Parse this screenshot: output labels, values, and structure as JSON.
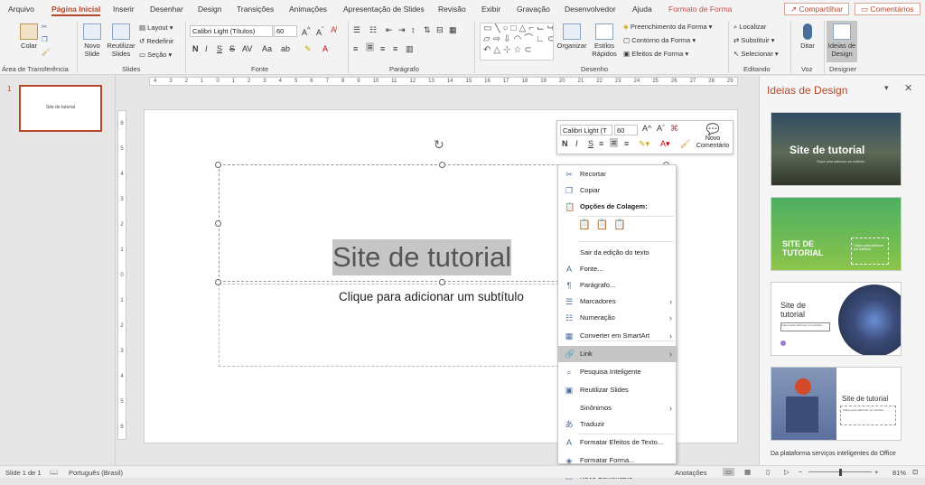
{
  "menu": {
    "tabs": [
      "Arquivo",
      "Página Inicial",
      "Inserir",
      "Desenhar",
      "Design",
      "Transições",
      "Animações",
      "Apresentação de Slides",
      "Revisão",
      "Exibir",
      "Gravação",
      "Desenvolvedor",
      "Ajuda",
      "Formato de Forma"
    ],
    "share": "Compartilhar",
    "comments": "Comentários"
  },
  "ribbon": {
    "clipboard": {
      "paste": "Colar",
      "label": "Área de Transferência"
    },
    "slides": {
      "new": "Novo Slide",
      "reuse": "Reutilizar Slides",
      "layout": "Layout",
      "reset": "Redefinir",
      "section": "Seção",
      "label": "Slides"
    },
    "font": {
      "name": "Calibri Light (Títulos)",
      "size": "60",
      "bold": "N",
      "italic": "I",
      "underline": "S",
      "strike": "S",
      "label": "Fonte"
    },
    "paragraph": {
      "label": "Parágrafo"
    },
    "drawing": {
      "arrange": "Organizar",
      "styles": "Estilos Rápidos",
      "fill": "Preenchimento da Forma",
      "outline": "Contorno da Forma",
      "effects": "Efeitos de Forma",
      "label": "Desenho"
    },
    "editing": {
      "find": "Localizar",
      "replace": "Substituir",
      "select": "Selecionar",
      "label": "Editando"
    },
    "voice": {
      "dictate": "Ditar",
      "label": "Voz"
    },
    "designer": {
      "ideas": "Ideias de Design",
      "label": "Designer"
    }
  },
  "thumbnail": {
    "number": "1",
    "title": "Site de tutorial"
  },
  "slide": {
    "title": "Site de tutorial",
    "subtitle": "Clique para adicionar um subtítulo"
  },
  "ruler": {
    "numbers": [
      "4",
      "3",
      "2",
      "1",
      "0",
      "1",
      "2",
      "3",
      "4",
      "5",
      "6",
      "7",
      "8",
      "9",
      "10",
      "11",
      "12",
      "13",
      "14",
      "15",
      "16",
      "17",
      "18",
      "19",
      "20",
      "21",
      "22",
      "23",
      "24",
      "25",
      "26",
      "27",
      "28",
      "29"
    ]
  },
  "minitoolbar": {
    "font": "Calibri Light (T",
    "size": "60",
    "bold": "N",
    "italic": "I",
    "underline": "S",
    "comment": "Novo Comentário"
  },
  "context_menu": {
    "items": [
      {
        "label": "Recortar",
        "icon": "cut-icon",
        "sub": false
      },
      {
        "label": "Copiar",
        "icon": "copy-icon",
        "sub": false
      },
      {
        "label": "Opções de Colagem:",
        "icon": "paste-icon",
        "sub": false,
        "bold": true
      },
      {
        "label": "Sair da edição do texto",
        "icon": "",
        "sub": false
      },
      {
        "label": "Fonte...",
        "icon": "font-icon",
        "sub": false
      },
      {
        "label": "Parágrafo...",
        "icon": "paragraph-icon",
        "sub": false
      },
      {
        "label": "Marcadores",
        "icon": "bullets-icon",
        "sub": true
      },
      {
        "label": "Numeração",
        "icon": "numbering-icon",
        "sub": true
      },
      {
        "label": "Converter em SmartArt",
        "icon": "smartart-icon",
        "sub": true
      },
      {
        "label": "Link",
        "icon": "link-icon",
        "sub": true,
        "highlighted": true
      },
      {
        "label": "Pesquisa Inteligente",
        "icon": "search-icon",
        "sub": false
      },
      {
        "label": "Reutilizar Slides",
        "icon": "reuse-slides-icon",
        "sub": false
      },
      {
        "label": "Sinônimos",
        "icon": "",
        "sub": true
      },
      {
        "label": "Traduzir",
        "icon": "translate-icon",
        "sub": false
      },
      {
        "label": "Formatar Efeitos de Texto...",
        "icon": "text-effects-icon",
        "sub": false
      },
      {
        "label": "Formatar Forma...",
        "icon": "format-shape-icon",
        "sub": false
      },
      {
        "label": "Novo Comentário",
        "icon": "comment-icon",
        "sub": false
      }
    ]
  },
  "design_ideas": {
    "title": "Ideias de Design",
    "cards": [
      {
        "title": "Site de tutorial",
        "subtitle": "Clique para adicionar um subtítulo"
      },
      {
        "title": "SITE DE TUTORIAL",
        "subtitle": "Clique para adicionar um subtítulo"
      },
      {
        "title": "Site de tutorial",
        "subtitle": "Clique para adicionar um subtítulo"
      },
      {
        "title": "Site de tutorial",
        "subtitle": "Clique para adicionar um subtítulo"
      }
    ],
    "footer": "Da plataforma serviços inteligentes do Office"
  },
  "status": {
    "slide": "Slide 1 de 1",
    "language": "Português (Brasil)",
    "notes": "Anotações",
    "zoom": "81%"
  },
  "colors": {
    "accent": "#b7472a",
    "highlight": "#c6c6c6"
  }
}
